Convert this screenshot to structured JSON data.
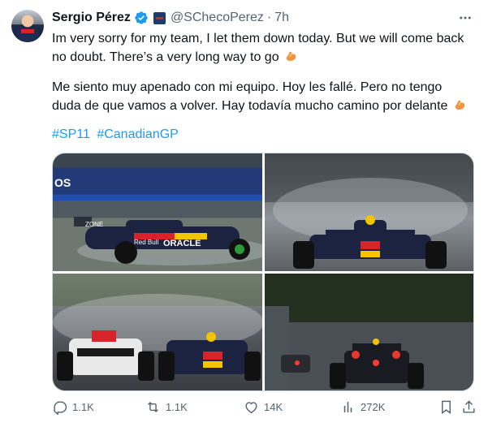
{
  "tweet": {
    "author_name": "Sergio Pérez",
    "handle": "@SChecoPerez",
    "separator": "·",
    "time": "7h",
    "text_en": "Im very sorry for my team, I let them down today. But we will come back no doubt. There’s a very long way to go",
    "text_es": "Me siento muy apenado con mi equipo. Hoy les fallé. Pero no tengo duda de que vamos a volver. Hay todavía mucho camino por delante",
    "hashtags": [
      "#SP11",
      "#CanadianGP"
    ],
    "emoji_icon": "flexed-biceps-icon",
    "photo_1_text": {
      "sponsor": "OS",
      "car_label_1": "Red Bull",
      "car_label_2": "ORACLE",
      "car_label_3": "ZONE"
    }
  },
  "actions": {
    "replies": "1.1K",
    "reposts": "1.1K",
    "likes": "14K",
    "views": "272K"
  },
  "colors": {
    "link": "#1d9bf0",
    "secondary_text": "#536471",
    "verified": "#1d9bf0"
  }
}
